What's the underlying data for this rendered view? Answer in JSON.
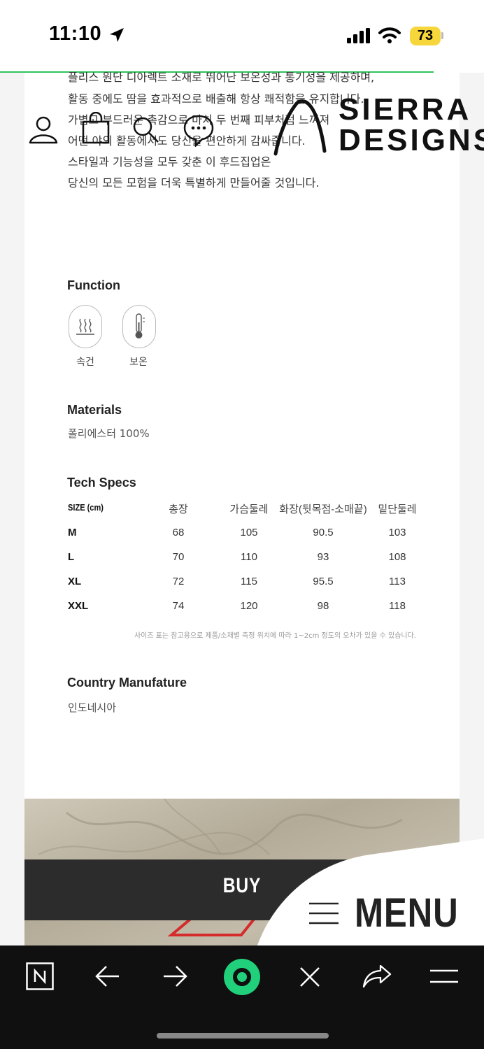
{
  "status_bar": {
    "time": "11:10",
    "battery": "73"
  },
  "header": {
    "brand_line1": "SIERRA",
    "brand_line2": "DESIGNS"
  },
  "description": {
    "lines": [
      "플리스 원단 디아렉트 소재로 뛰어난 보온성과 통기성을 제공하며,",
      "활동 중에도 땀을 효과적으로 배출해 항상 쾌적함을 유지합니다.",
      "가볍고 부드러운 촉감으로 마치 두 번째 피부처럼 느껴져",
      "어떤 야외 활동에서도 당신을 편안하게 감싸줍니다.",
      "스타일과 기능성을 모두 갖춘 이 후드집업은",
      "당신의 모든 모험을 더욱 특별하게 만들어줄 것입니다."
    ]
  },
  "function": {
    "title": "Function",
    "items": [
      {
        "label": "속건",
        "icon": "quick-dry-icon"
      },
      {
        "label": "보온",
        "icon": "thermometer-icon"
      }
    ]
  },
  "materials": {
    "title": "Materials",
    "value": "폴리에스터 100%"
  },
  "tech_specs": {
    "title": "Tech Specs",
    "headers": [
      "SIZE (cm)",
      "총장",
      "가슴둘레",
      "화장(뒷목점-소매끝)",
      "밑단둘레"
    ],
    "rows": [
      [
        "M",
        "68",
        "105",
        "90.5",
        "103"
      ],
      [
        "L",
        "70",
        "110",
        "93",
        "108"
      ],
      [
        "XL",
        "72",
        "115",
        "95.5",
        "113"
      ],
      [
        "XXL",
        "74",
        "120",
        "98",
        "118"
      ]
    ],
    "note": "사이즈 표는 참고용으로 제품/소재별 측정 위치에 따라 1~2cm 정도의 오차가 있을 수 있습니다."
  },
  "country": {
    "title": "Country Manufature",
    "value": "인도네시아"
  },
  "buy_label": "BUY",
  "menu_label": "MENU",
  "colors": {
    "progress": "#2ec25c",
    "battery": "#f6d63b",
    "buy_bar": "#2c2c2c",
    "toolbar": "#101010",
    "record_button": "#21d07a"
  },
  "toolbar_icons": [
    "naver-n-icon",
    "back-arrow-icon",
    "forward-arrow-icon",
    "record-icon",
    "close-icon",
    "share-icon",
    "hamburger-icon"
  ]
}
